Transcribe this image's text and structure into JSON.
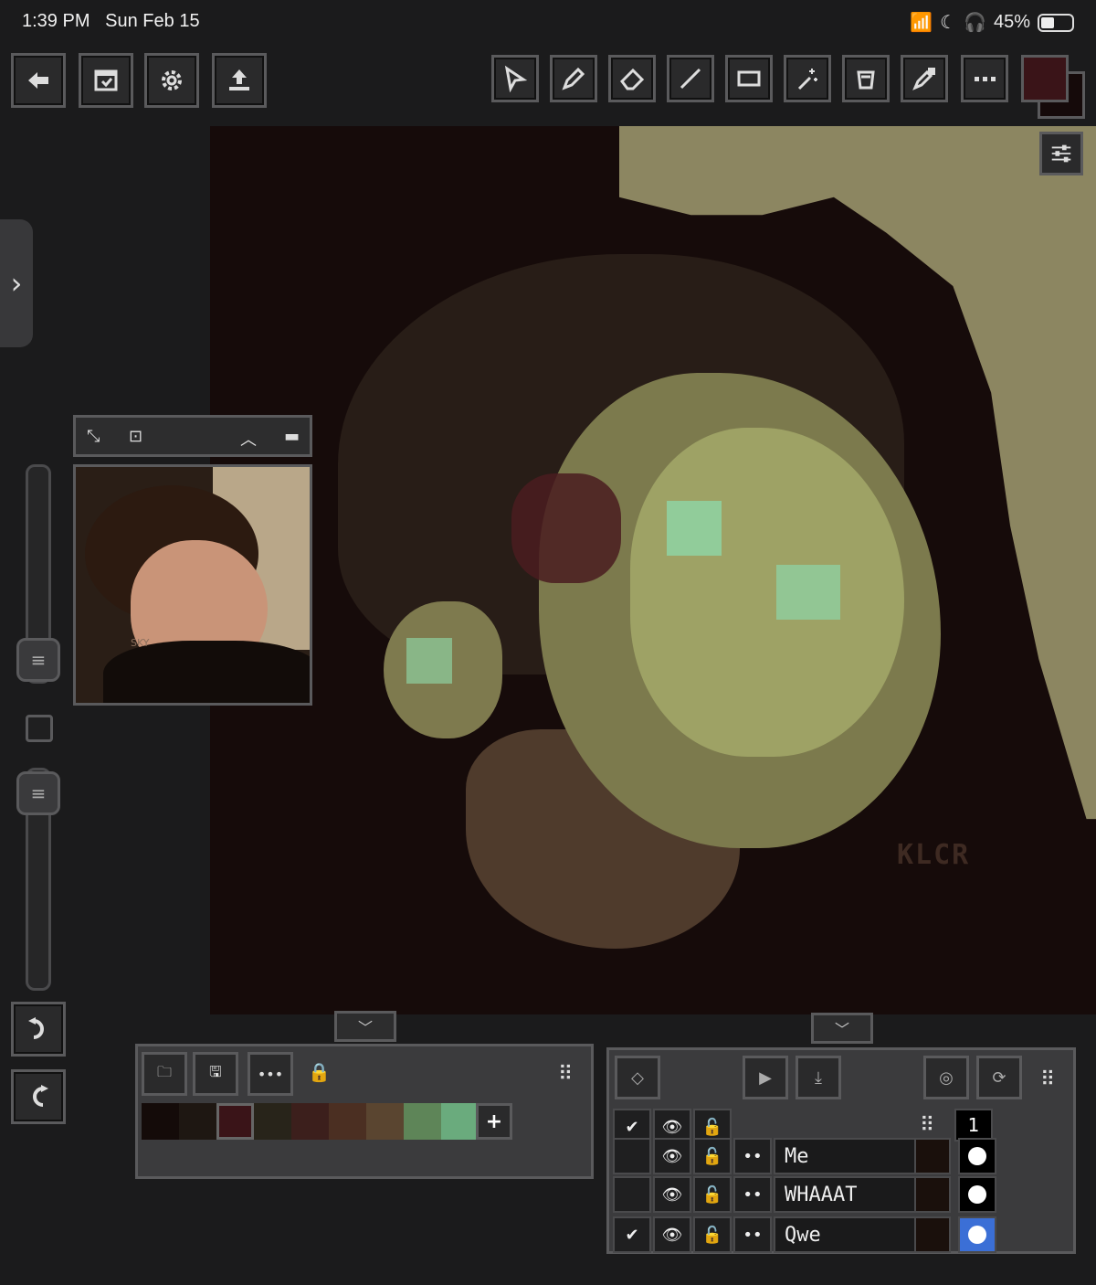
{
  "status_bar": {
    "time": "1:39 PM",
    "date": "Sun Feb 15",
    "battery": "45%"
  },
  "toolbar_left": [
    {
      "name": "back-icon"
    },
    {
      "name": "animation-icon"
    },
    {
      "name": "settings-gear-icon"
    },
    {
      "name": "export-icon"
    }
  ],
  "toolbar_right": [
    {
      "name": "select-tool-icon"
    },
    {
      "name": "pencil-tool-icon"
    },
    {
      "name": "eraser-tool-icon"
    },
    {
      "name": "line-tool-icon"
    },
    {
      "name": "rectangle-tool-icon"
    },
    {
      "name": "magic-wand-icon"
    },
    {
      "name": "bucket-fill-icon"
    },
    {
      "name": "eyedropper-icon"
    },
    {
      "name": "more-icon"
    }
  ],
  "colors": {
    "primary": "#3a1418",
    "secondary": "#150a0a"
  },
  "canvas": {
    "signature": "KLCR"
  },
  "reference": {
    "watermark": "SKY"
  },
  "palette": {
    "swatches": [
      "#140b09",
      "#1e1712",
      "#3a1418",
      "#28241a",
      "#3c1f1c",
      "#4b2f22",
      "#5a4530",
      "#5e8558",
      "#6aab7d"
    ],
    "selected_index": 2,
    "add_label": "+"
  },
  "layers": {
    "frame_number": "1",
    "items": [
      {
        "name": "Me",
        "visible": true,
        "checked": false
      },
      {
        "name": "WHAAAT",
        "visible": true,
        "checked": false
      },
      {
        "name": "Qwe",
        "visible": true,
        "checked": true,
        "active": true
      }
    ]
  }
}
